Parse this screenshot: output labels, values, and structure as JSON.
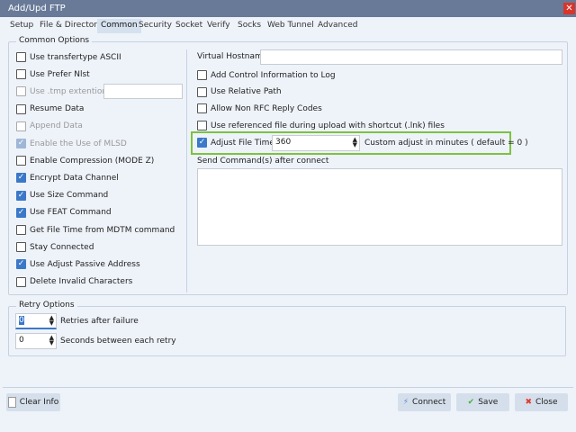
{
  "window": {
    "title": "Add/Upd FTP"
  },
  "tabs": [
    "Setup",
    "File & Directory",
    "Common",
    "Security",
    "Socket",
    "Verify",
    "Socks",
    "Web Tunnel",
    "Advanced"
  ],
  "active_tab": "Common",
  "common_options": {
    "label": "Common Options",
    "left": [
      {
        "label": "Use transfertype ASCII",
        "checked": false,
        "disabled": false
      },
      {
        "label": "Use Prefer Nlst",
        "checked": false,
        "disabled": false
      },
      {
        "label": "Use .tmp extention",
        "checked": false,
        "disabled": true
      },
      {
        "label": "Resume Data",
        "checked": false,
        "disabled": false
      },
      {
        "label": "Append Data",
        "checked": false,
        "disabled": true
      },
      {
        "label": "Enable the Use of MLSD",
        "checked": true,
        "disabled": true
      },
      {
        "label": "Enable Compression (MODE Z)",
        "checked": false,
        "disabled": false
      },
      {
        "label": "Encrypt Data Channel",
        "checked": true,
        "disabled": false
      },
      {
        "label": "Use Size Command",
        "checked": true,
        "disabled": false
      },
      {
        "label": "Use FEAT Command",
        "checked": true,
        "disabled": false
      },
      {
        "label": "Get File Time from MDTM command",
        "checked": false,
        "disabled": false
      },
      {
        "label": "Stay Connected",
        "checked": false,
        "disabled": false
      },
      {
        "label": "Use Adjust Passive Address",
        "checked": true,
        "disabled": false
      },
      {
        "label": "Delete Invalid Characters",
        "checked": false,
        "disabled": false
      }
    ],
    "tmp_extension_value": "",
    "virtual_hostname_label": "Virtual Hostname",
    "virtual_hostname_value": "",
    "right": [
      {
        "label": "Add Control Information to Log",
        "checked": false
      },
      {
        "label": "Use Relative Path",
        "checked": false
      },
      {
        "label": "Allow Non RFC Reply Codes",
        "checked": false
      },
      {
        "label": "Use referenced file during upload with shortcut (.lnk) files",
        "checked": false
      }
    ],
    "adjust_file_times": {
      "label": "Adjust File Times",
      "checked": true,
      "value": "360",
      "hint": "Custom adjust in minutes ( default = 0 )",
      "highlight": "#7cc242"
    },
    "send_commands_label": "Send Command(s) after connect",
    "send_commands_value": ""
  },
  "retry_options": {
    "label": "Retry Options",
    "retries_value": "0",
    "retries_label": "Retries after failure",
    "seconds_value": "0",
    "seconds_label": "Seconds between each retry"
  },
  "footer": {
    "clear_info": "Clear Info",
    "connect": "Connect",
    "save": "Save",
    "close": "Close"
  }
}
